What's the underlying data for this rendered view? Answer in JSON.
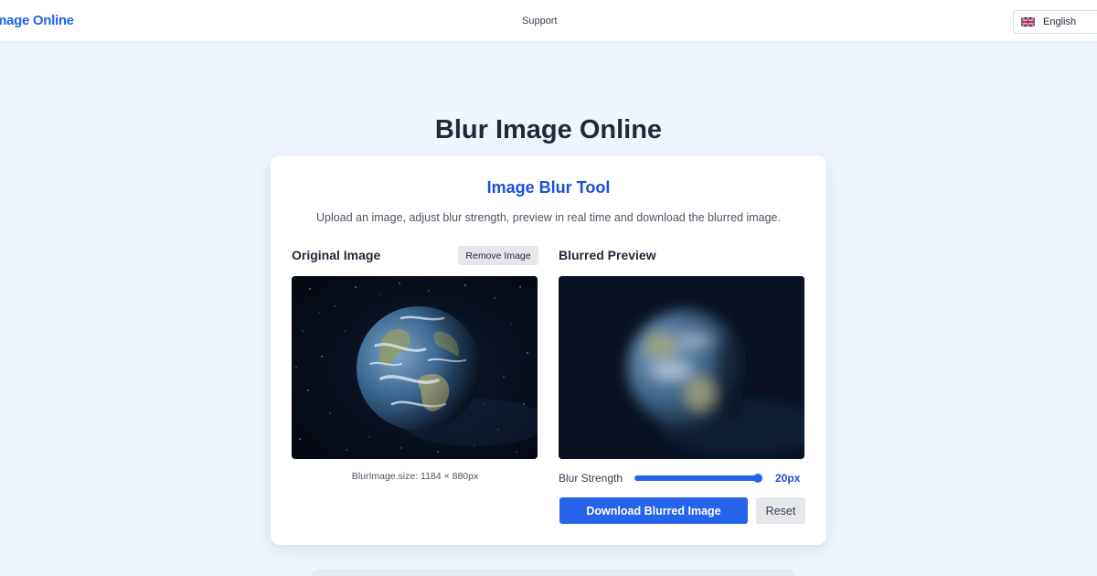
{
  "nav": {
    "logo": "mage Online",
    "support": "Support",
    "language": "English",
    "flag_icon": "uk-flag-icon"
  },
  "page": {
    "title": "Blur Image Online"
  },
  "tool": {
    "title": "Image Blur Tool",
    "description": "Upload an image, adjust blur strength, preview in real time and download the blurred image.",
    "original_label": "Original Image",
    "remove_button": "Remove Image",
    "preview_label": "Blurred Preview",
    "size_note": "BlurImage.size: 1184 × 880px",
    "slider_label": "Blur Strength",
    "slider_value_text": "20px",
    "slider_fraction": 0.99,
    "download_button": "Download Blurred Image",
    "reset_button": "Reset"
  },
  "colors": {
    "accent": "#2563eb",
    "title_blue": "#1d4ed8",
    "page_bg": "#eef5fd"
  }
}
